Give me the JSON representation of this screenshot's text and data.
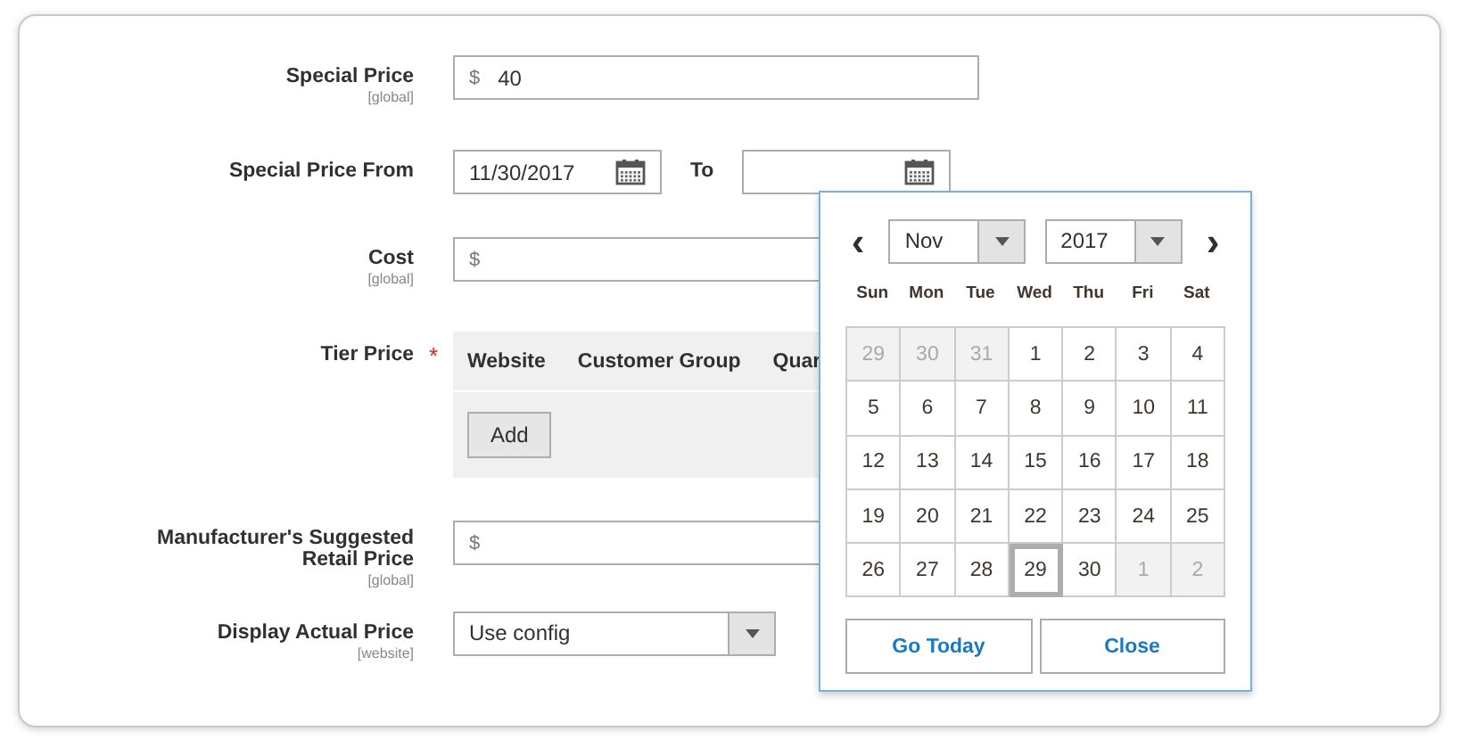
{
  "fields": [
    {
      "kind": "price",
      "label": "Special Price",
      "scope": "[global]",
      "currency": "$",
      "value": "40"
    },
    {
      "kind": "daterange",
      "label": "Special Price From",
      "value": "11/30/2017",
      "to_label": "To"
    },
    {
      "kind": "price",
      "label": "Cost",
      "scope": "[global]",
      "currency": "$"
    },
    {
      "kind": "tier",
      "label": "Tier Price",
      "required_mark": "*",
      "columns": [
        "Website",
        "Customer Group",
        "Quar"
      ],
      "button": "Add"
    },
    {
      "kind": "price",
      "label": "Manufacturer's Suggested Retail Price",
      "scope": "[global]",
      "currency": "$"
    },
    {
      "kind": "select",
      "label": "Display Actual Price",
      "scope": "[website]",
      "value": "Use config"
    }
  ],
  "datepicker": {
    "prev": "‹",
    "next": "›",
    "month": "Nov",
    "year": "2017",
    "weekdays": [
      "Sun",
      "Mon",
      "Tue",
      "Wed",
      "Thu",
      "Fri",
      "Sat"
    ],
    "days": [
      {
        "label": "29",
        "muted": true,
        "today": false
      },
      {
        "label": "30",
        "muted": true,
        "today": false
      },
      {
        "label": "31",
        "muted": true,
        "today": false
      },
      {
        "label": "1",
        "muted": false,
        "today": false
      },
      {
        "label": "2",
        "muted": false,
        "today": false
      },
      {
        "label": "3",
        "muted": false,
        "today": false
      },
      {
        "label": "4",
        "muted": false,
        "today": false
      },
      {
        "label": "5",
        "muted": false,
        "today": false
      },
      {
        "label": "6",
        "muted": false,
        "today": false
      },
      {
        "label": "7",
        "muted": false,
        "today": false
      },
      {
        "label": "8",
        "muted": false,
        "today": false
      },
      {
        "label": "9",
        "muted": false,
        "today": false
      },
      {
        "label": "10",
        "muted": false,
        "today": false
      },
      {
        "label": "11",
        "muted": false,
        "today": false
      },
      {
        "label": "12",
        "muted": false,
        "today": false
      },
      {
        "label": "13",
        "muted": false,
        "today": false
      },
      {
        "label": "14",
        "muted": false,
        "today": false
      },
      {
        "label": "15",
        "muted": false,
        "today": false
      },
      {
        "label": "16",
        "muted": false,
        "today": false
      },
      {
        "label": "17",
        "muted": false,
        "today": false
      },
      {
        "label": "18",
        "muted": false,
        "today": false
      },
      {
        "label": "19",
        "muted": false,
        "today": false
      },
      {
        "label": "20",
        "muted": false,
        "today": false
      },
      {
        "label": "21",
        "muted": false,
        "today": false
      },
      {
        "label": "22",
        "muted": false,
        "today": false
      },
      {
        "label": "23",
        "muted": false,
        "today": false
      },
      {
        "label": "24",
        "muted": false,
        "today": false
      },
      {
        "label": "25",
        "muted": false,
        "today": false
      },
      {
        "label": "26",
        "muted": false,
        "today": false
      },
      {
        "label": "27",
        "muted": false,
        "today": false
      },
      {
        "label": "28",
        "muted": false,
        "today": false
      },
      {
        "label": "29",
        "muted": false,
        "today": true
      },
      {
        "label": "30",
        "muted": false,
        "today": false
      },
      {
        "label": "1",
        "muted": true,
        "today": false
      },
      {
        "label": "2",
        "muted": true,
        "today": false
      }
    ],
    "buttons": [
      "Go Today",
      "Close"
    ]
  }
}
